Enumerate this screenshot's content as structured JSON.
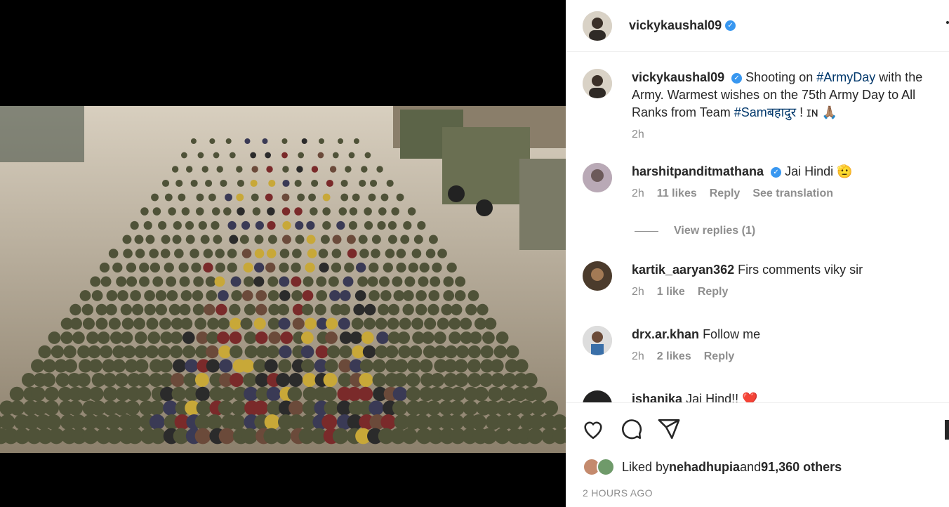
{
  "post": {
    "username": "vickykaushal09",
    "caption_pre": "Shooting on ",
    "caption_tag1": "#ArmyDay",
    "caption_mid": " with the Army. Warmest wishes on the 75th Army Day to All Ranks from Team ",
    "caption_tag2": "#Samबहादुर",
    "caption_post": " ! ɪɴ 🙏🏽",
    "caption_time": "2h",
    "likes_prefix": "Liked by ",
    "likes_user": "nehadhupia",
    "likes_mid": " and ",
    "likes_count": "91,360 others",
    "timestamp": "2 HOURS AGO"
  },
  "comments": [
    {
      "user": "harshitpanditmathana",
      "verified": true,
      "text": "Jai Hindi 🫡",
      "time": "2h",
      "likes": "11 likes",
      "reply": "Reply",
      "translate": "See translation"
    },
    {
      "user": "kartik_aaryan362",
      "verified": false,
      "text": "Firs comments viky sir",
      "time": "2h",
      "likes": "1 like",
      "reply": "Reply"
    },
    {
      "user": "drx.ar.khan",
      "verified": false,
      "text": "Follow me",
      "time": "2h",
      "likes": "2 likes",
      "reply": "Reply"
    },
    {
      "user": "ishanika",
      "verified": false,
      "text": "Jai Hind!! ❤️"
    }
  ],
  "view_replies": "View replies (1)",
  "icons": [
    "heart-icon",
    "comment-icon",
    "share-icon",
    "more-icon"
  ]
}
